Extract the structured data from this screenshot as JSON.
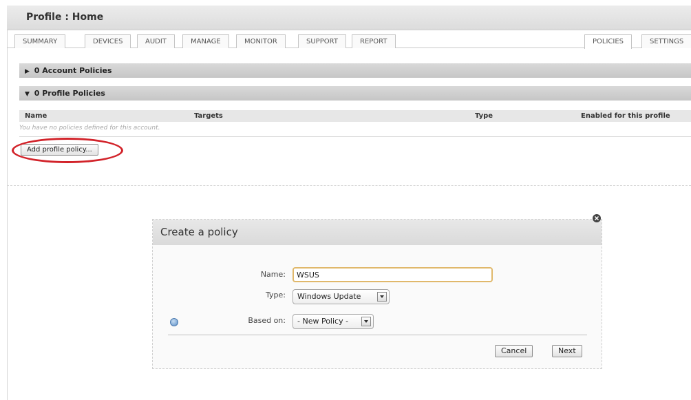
{
  "header": {
    "title": "Profile : Home"
  },
  "tabs": [
    {
      "label": "SUMMARY"
    },
    {
      "label": "DEVICES"
    },
    {
      "label": "AUDIT"
    },
    {
      "label": "MANAGE"
    },
    {
      "label": "MONITOR"
    },
    {
      "label": "SUPPORT"
    },
    {
      "label": "REPORT"
    },
    {
      "label": "POLICIES"
    },
    {
      "label": "SETTINGS"
    }
  ],
  "sections": {
    "account": {
      "arrow": "▶",
      "label": "0 Account Policies"
    },
    "profile": {
      "arrow": "▼",
      "label": "0 Profile Policies"
    }
  },
  "table": {
    "columns": {
      "name": "Name",
      "targets": "Targets",
      "type": "Type",
      "enabled": "Enabled for this profile"
    },
    "empty_message": "You have no policies defined for this account."
  },
  "add_button_label": "Add profile policy...",
  "dialog": {
    "title": "Create a policy",
    "name_label": "Name:",
    "name_value": "WSUS",
    "type_label": "Type:",
    "type_value": "Windows Update",
    "based_on_label": "Based on:",
    "based_on_value": "- New Policy -",
    "cancel_label": "Cancel",
    "next_label": "Next"
  },
  "colors": {
    "highlight": "#d2232a",
    "input_focus": "#e0b86b"
  }
}
